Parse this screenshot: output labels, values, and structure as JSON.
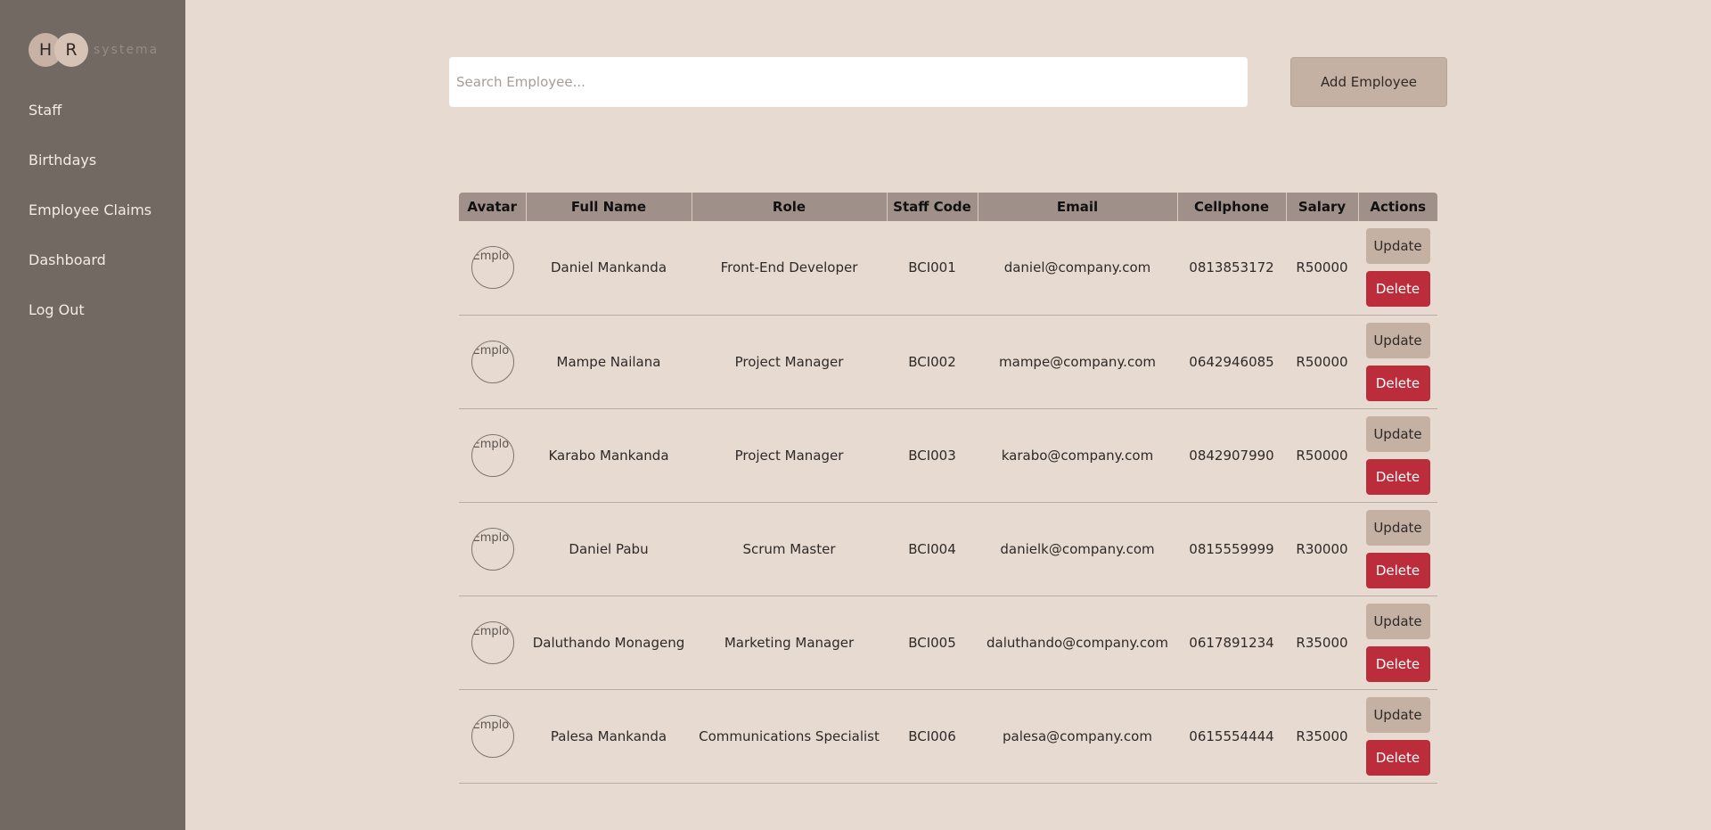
{
  "sidebar": {
    "logo": {
      "letter1": "H",
      "letter2": "R",
      "text": "systema"
    },
    "items": [
      {
        "label": "Staff"
      },
      {
        "label": "Birthdays"
      },
      {
        "label": "Employee Claims"
      },
      {
        "label": "Dashboard"
      },
      {
        "label": "Log Out"
      }
    ]
  },
  "toolbar": {
    "search_placeholder": "Search Employee...",
    "search_value": "",
    "add_label": "Add Employee"
  },
  "table": {
    "headers": [
      "Avatar",
      "Full Name",
      "Role",
      "Staff Code",
      "Email",
      "Cellphone",
      "Salary",
      "Actions"
    ],
    "avatar_alt": "Emplo",
    "update_label": "Update",
    "delete_label": "Delete",
    "rows": [
      {
        "name": "Daniel Mankanda",
        "role": "Front-End Developer",
        "code": "BCI001",
        "email": "daniel@company.com",
        "cell": "0813853172",
        "salary": "R50000"
      },
      {
        "name": "Mampe Nailana",
        "role": "Project Manager",
        "code": "BCI002",
        "email": "mampe@company.com",
        "cell": "0642946085",
        "salary": "R50000"
      },
      {
        "name": "Karabo Mankanda",
        "role": "Project Manager",
        "code": "BCI003",
        "email": "karabo@company.com",
        "cell": "0842907990",
        "salary": "R50000"
      },
      {
        "name": "Daniel Pabu",
        "role": "Scrum Master",
        "code": "BCI004",
        "email": "danielk@company.com",
        "cell": "0815559999",
        "salary": "R30000"
      },
      {
        "name": "Daluthando Monageng",
        "role": "Marketing Manager",
        "code": "BCI005",
        "email": "daluthando@company.com",
        "cell": "0617891234",
        "salary": "R35000"
      },
      {
        "name": "Palesa Mankanda",
        "role": "Communications Specialist",
        "code": "BCI006",
        "email": "palesa@company.com",
        "cell": "0615554444",
        "salary": "R35000"
      }
    ]
  },
  "colors": {
    "background": "#e7dad1",
    "sidebar": "#726963",
    "header": "#a0908a",
    "update_button": "#c4b1a4",
    "delete_button": "#bb2d3b"
  }
}
